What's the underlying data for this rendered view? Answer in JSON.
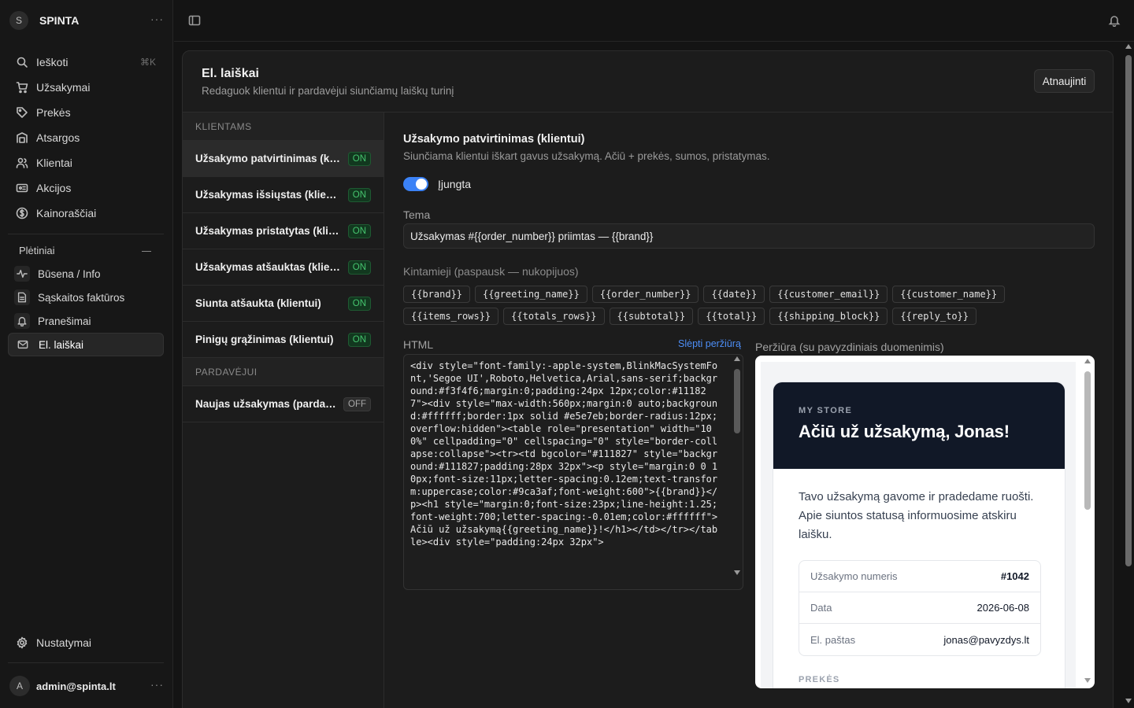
{
  "brand": {
    "logo_letter": "S",
    "name": "SPINTA",
    "menu": "···"
  },
  "nav": {
    "search_label": "Ieškoti",
    "search_shortcut": "⌘K",
    "items": [
      {
        "label": "Užsakymai",
        "icon": "cart-icon"
      },
      {
        "label": "Prekės",
        "icon": "tag-icon"
      },
      {
        "label": "Atsargos",
        "icon": "warehouse-icon"
      },
      {
        "label": "Klientai",
        "icon": "users-icon"
      },
      {
        "label": "Akcijos",
        "icon": "ticket-icon"
      },
      {
        "label": "Kainoraščiai",
        "icon": "dollar-icon"
      }
    ]
  },
  "extensions": {
    "title": "Plėtiniai",
    "items": [
      {
        "label": "Būsena / Info",
        "icon": "activity-icon"
      },
      {
        "label": "Sąskaitos faktūros",
        "icon": "invoice-icon"
      },
      {
        "label": "Pranešimai",
        "icon": "bell-icon"
      },
      {
        "label": "El. laiškai",
        "icon": "mail-icon",
        "active": true
      }
    ]
  },
  "settings_label": "Nustatymai",
  "user": {
    "avatar_letter": "A",
    "email": "admin@spinta.lt",
    "menu": "···"
  },
  "page": {
    "title": "El. laiškai",
    "subtitle": "Redaguok klientui ir pardavėjui siunčiamų laiškų turinį",
    "refresh_label": "Atnaujinti"
  },
  "templates": {
    "customers_header": "KLIENTAMS",
    "customers": [
      {
        "name": "Užsakymo patvirtinimas (klientui)",
        "status": "ON",
        "active": true
      },
      {
        "name": "Užsakymas išsiųstas (klientui)",
        "status": "ON"
      },
      {
        "name": "Užsakymas pristatytas (klientui)",
        "status": "ON"
      },
      {
        "name": "Užsakymas atšauktas (klientui)",
        "status": "ON"
      },
      {
        "name": "Siunta atšaukta (klientui)",
        "status": "ON"
      },
      {
        "name": "Pinigų grąžinimas (klientui)",
        "status": "ON"
      }
    ],
    "sellers_header": "PARDAVĖJUI",
    "sellers": [
      {
        "name": "Naujas užsakymas (pardavėjui)",
        "status": "OFF"
      }
    ]
  },
  "detail": {
    "title": "Užsakymo patvirtinimas (klientui)",
    "description": "Siunčiama klientui iškart gavus užsakymą. Ačiū + prekės, sumos, pristatymas.",
    "enabled": true,
    "enabled_label": "Įjungta",
    "subject_label": "Tema",
    "subject_value": "Užsakymas #{{order_number}} priimtas — {{brand}}",
    "variables_label": "Kintamieji (paspausk — nukopijuos)",
    "variables": [
      "{{brand}}",
      "{{greeting_name}}",
      "{{order_number}}",
      "{{date}}",
      "{{customer_email}}",
      "{{customer_name}}",
      "{{items_rows}}",
      "{{totals_rows}}",
      "{{subtotal}}",
      "{{total}}",
      "{{shipping_block}}",
      "{{reply_to}}"
    ],
    "html_label": "HTML",
    "hide_preview_label": "Slėpti peržiūrą",
    "html_value": "<div style=\"font-family:-apple-system,BlinkMacSystemFont,'Segoe UI',Roboto,Helvetica,Arial,sans-serif;background:#f3f4f6;margin:0;padding:24px 12px;color:#111827\"><div style=\"max-width:560px;margin:0 auto;background:#ffffff;border:1px solid #e5e7eb;border-radius:12px;overflow:hidden\"><table role=\"presentation\" width=\"100%\" cellpadding=\"0\" cellspacing=\"0\" style=\"border-collapse:collapse\"><tr><td bgcolor=\"#111827\" style=\"background:#111827;padding:28px 32px\"><p style=\"margin:0 0 10px;font-size:11px;letter-spacing:0.12em;text-transform:uppercase;color:#9ca3af;font-weight:600\">{{brand}}</p><h1 style=\"margin:0;font-size:23px;line-height:1.25;font-weight:700;letter-spacing:-0.01em;color:#ffffff\">Ačiū už užsakymą{{greeting_name}}!</h1></td></tr></table><div style=\"padding:24px 32px\">",
    "preview_label": "Peržiūra (su pavyzdiniais duomenimis)"
  },
  "preview": {
    "brand": "MY STORE",
    "heading": "Ačiū už užsakymą, Jonas!",
    "paragraph": "Tavo užsakymą gavome ir pradedame ruošti. Apie siuntos statusą informuosime atskiru laišku.",
    "rows": [
      {
        "key": "Užsakymo numeris",
        "value": "#1042"
      },
      {
        "key": "Data",
        "value": "2026-06-08"
      },
      {
        "key": "El. paštas",
        "value": "jonas@pavyzdys.lt"
      }
    ],
    "items_label": "PREKĖS"
  },
  "colors": {
    "accent": "#3b82f6",
    "on_badge": "#46c46e",
    "email_header": "#111827"
  }
}
